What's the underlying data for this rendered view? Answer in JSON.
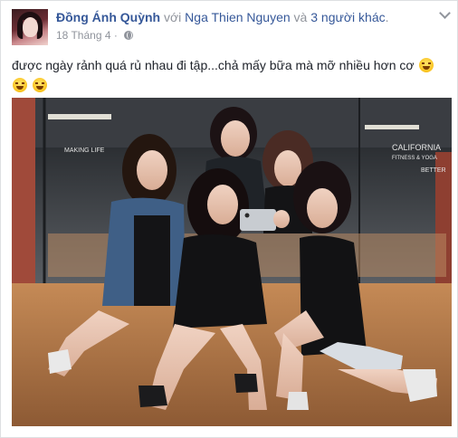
{
  "post": {
    "author": "Đồng Ánh Quỳnh",
    "with_word": "với",
    "tagged_friend": "Nga Thien Nguyen",
    "and_word": "và",
    "others": "3 người khác",
    "date": "18 Tháng 4",
    "separator": "·",
    "privacy_icon": "globe-icon",
    "menu_icon": "chevron-down-icon",
    "text": "được ngày rảnh quá rủ nhau đi tập...chả mấy bữa mà mỡ nhiều hơn cơ",
    "emojis": [
      "laughing-tears-emoji",
      "laughing-tears-emoji",
      "laughing-tears-emoji"
    ]
  },
  "photo": {
    "signs": [
      "CALIFORNIA",
      "FITNESS & YOGA",
      "MAKING LIFE",
      "BETTER"
    ]
  },
  "colors": {
    "link": "#365899",
    "meta": "#90949c",
    "text": "#1d2129",
    "background": "#ffffff"
  }
}
